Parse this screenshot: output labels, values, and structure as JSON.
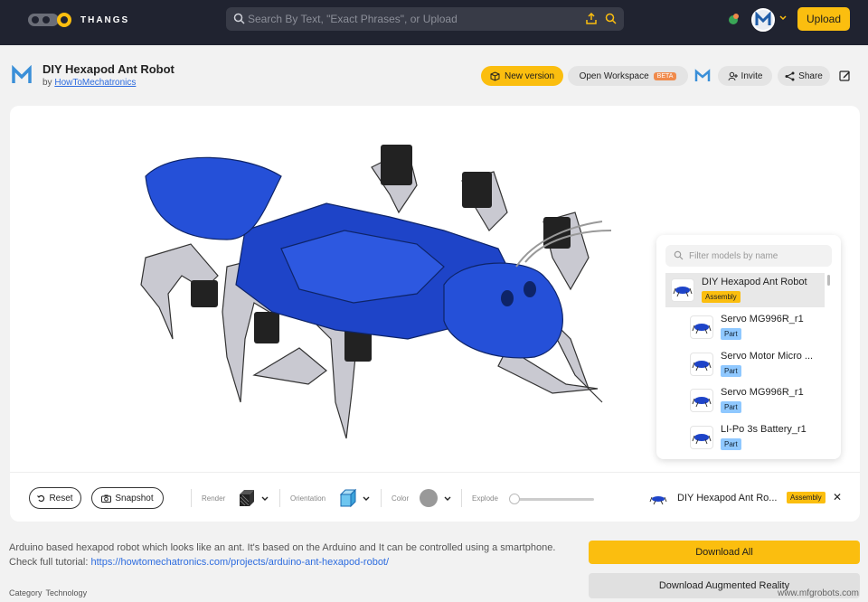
{
  "header": {
    "brand": "THANGS",
    "search_placeholder": "Search By Text, \"Exact Phrases\", or Upload",
    "upload_label": "Upload"
  },
  "model": {
    "title": "DIY Hexapod Ant Robot",
    "by_prefix": "by",
    "author": "HowToMechatronics"
  },
  "actions": {
    "new_version": "New version",
    "open_workspace": "Open Workspace",
    "beta": "BETA",
    "invite": "Invite",
    "share": "Share"
  },
  "tree": {
    "filter_placeholder": "Filter models by name",
    "items": [
      {
        "name": "DIY Hexapod Ant Robot",
        "tag": "Assembly"
      },
      {
        "name": "Servo MG996R_r1",
        "tag": "Part"
      },
      {
        "name": "Servo Motor Micro ...",
        "tag": "Part"
      },
      {
        "name": "Servo MG996R_r1",
        "tag": "Part"
      },
      {
        "name": "LI-Po 3s Battery_r1",
        "tag": "Part"
      }
    ]
  },
  "toolbar": {
    "reset": "Reset",
    "snapshot": "Snapshot",
    "render_label": "Render",
    "orientation_label": "Orientation",
    "color_label": "Color",
    "explode_label": "Explode",
    "explode_value": 0,
    "selected_name": "DIY Hexapod Ant Ro...",
    "selected_tag": "Assembly"
  },
  "description": {
    "text": "Arduino based hexapod robot which looks like an ant. It's based on the Arduino and It can be controlled using a smartphone. Check full tutorial: ",
    "link": "https://howtomechatronics.com/projects/arduino-ant-hexapod-robot/"
  },
  "category": {
    "label": "Category",
    "value": "Technology"
  },
  "downloads": {
    "all": "Download All",
    "ar": "Download Augmented Reality"
  },
  "watermark": "www.mfgrobots.com",
  "colors": {
    "accent": "#fbbe0f",
    "topbar": "#202330",
    "robot_blue": "#1e44c8"
  }
}
